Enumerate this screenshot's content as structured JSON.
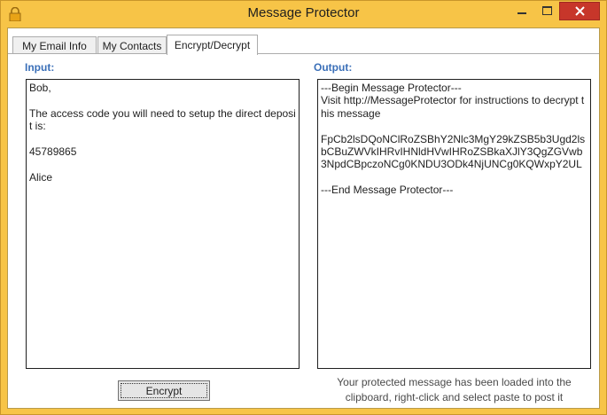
{
  "window": {
    "title": "Message Protector",
    "accent": "#f7c447",
    "close_color": "#c7362a"
  },
  "tabs": [
    {
      "label": "My Email Info",
      "selected": false
    },
    {
      "label": "My Contacts",
      "selected": false
    },
    {
      "label": "Encrypt/Decrypt",
      "selected": true
    }
  ],
  "input": {
    "label": "Input:",
    "text": "Bob,\n\nThe access code you will need to setup the direct deposit is:\n\n45789865\n\nAlice"
  },
  "output": {
    "label": "Output:",
    "text": "---Begin Message Protector---\nVisit http://MessageProtector for instructions to decrypt this message\n\nFpCb2lsDQoNClRoZSBhY2Nlc3MgY29kZSB5b3Ugd2lsbCBuZWVkIHRvIHNldHVwIHRoZSBkaXJlY3QgZGVwb3NpdCBpczoNCg0KNDU3ODk4NjUNCg0KQWxpY2UL\n\n---End Message Protector---"
  },
  "encrypt_button": {
    "label": "Encrypt"
  },
  "status": {
    "message": "Your protected message has been loaded into the clipboard, right-click and select paste to post it"
  },
  "icons": {
    "app": "lock-icon",
    "minimize": "minimize-icon",
    "maximize": "maximize-icon",
    "close": "close-icon"
  }
}
